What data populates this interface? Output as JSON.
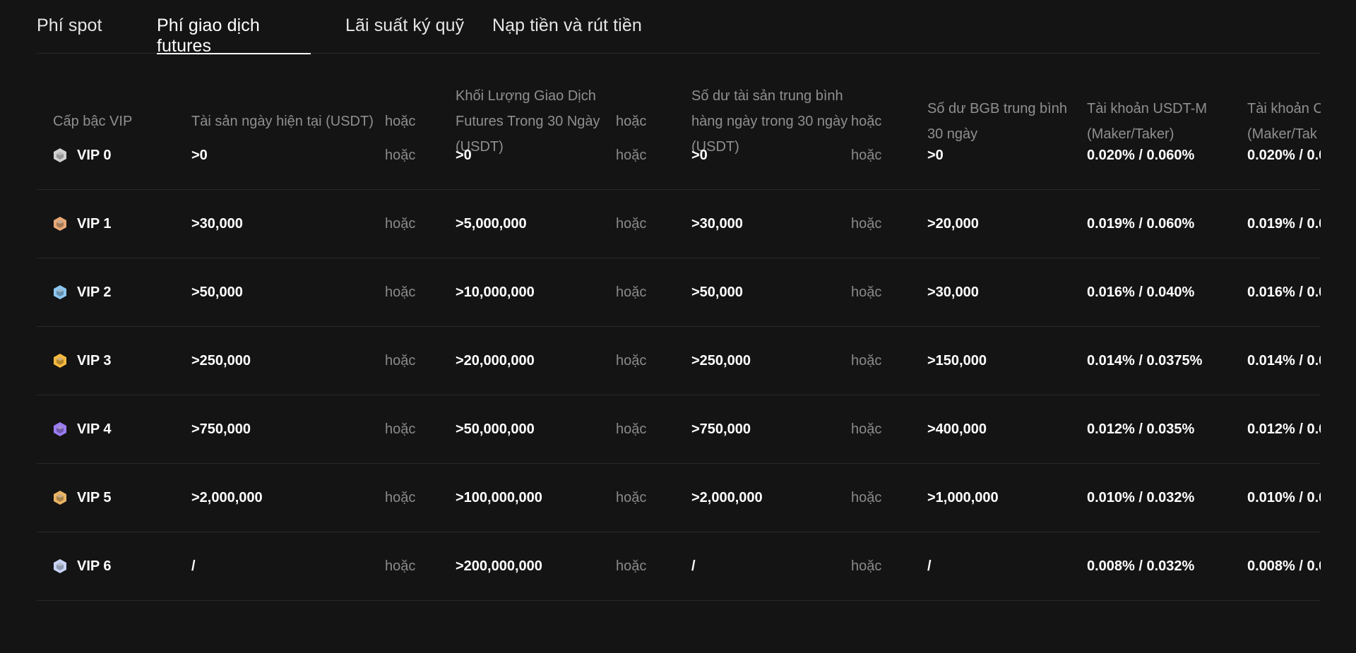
{
  "tabs": [
    {
      "label": "Phí spot",
      "active": false
    },
    {
      "label": "Phí giao dịch futures",
      "active": true
    },
    {
      "label": "Lãi suất ký quỹ",
      "active": false
    },
    {
      "label": "Nạp tiền và rút tiền",
      "active": false
    }
  ],
  "table": {
    "headers": {
      "vip": "Cấp bậc VIP",
      "assets": "Tài sản ngày hiện tại (USDT)",
      "or1": "hoặc",
      "volume": "Khối Lượng Giao Dịch Futures Trong 30 Ngày (USDT)",
      "or2": "hoặc",
      "avg_assets": "Số dư tài sản trung bình hàng ngày trong 30 ngày (USDT)",
      "or3": "hoặc",
      "bgb": "Số dư BGB trung bình 30 ngày",
      "usdt_m": "Tài khoản USDT-M (Maker/Taker)",
      "coin_m": "Tài khoản C (Maker/Tak"
    },
    "or_label": "hoặc",
    "rows": [
      {
        "vip": "VIP 0",
        "icon_color": "#d0d0d0",
        "assets": ">0",
        "volume": ">0",
        "avg_assets": ">0",
        "bgb": ">0",
        "usdt_m": "0.020% / 0.060%",
        "coin_m": "0.020% / 0.0"
      },
      {
        "vip": "VIP 1",
        "icon_color": "#e7a877",
        "assets": ">30,000",
        "volume": ">5,000,000",
        "avg_assets": ">30,000",
        "bgb": ">20,000",
        "usdt_m": "0.019% / 0.060%",
        "coin_m": "0.019% / 0.0"
      },
      {
        "vip": "VIP 2",
        "icon_color": "#8cc6f0",
        "assets": ">50,000",
        "volume": ">10,000,000",
        "avg_assets": ">50,000",
        "bgb": ">30,000",
        "usdt_m": "0.016% / 0.040%",
        "coin_m": "0.016% / 0.0"
      },
      {
        "vip": "VIP 3",
        "icon_color": "#f5b93e",
        "assets": ">250,000",
        "volume": ">20,000,000",
        "avg_assets": ">250,000",
        "bgb": ">150,000",
        "usdt_m": "0.014% / 0.0375%",
        "coin_m": "0.014% / 0.0"
      },
      {
        "vip": "VIP 4",
        "icon_color": "#9b7cf2",
        "assets": ">750,000",
        "volume": ">50,000,000",
        "avg_assets": ">750,000",
        "bgb": ">400,000",
        "usdt_m": "0.012% / 0.035%",
        "coin_m": "0.012% / 0.0"
      },
      {
        "vip": "VIP 5",
        "icon_color": "#e9b564",
        "assets": ">2,000,000",
        "volume": ">100,000,000",
        "avg_assets": ">2,000,000",
        "bgb": ">1,000,000",
        "usdt_m": "0.010% / 0.032%",
        "coin_m": "0.010% / 0.0"
      },
      {
        "vip": "VIP 6",
        "icon_color": "#c8d4f4",
        "assets": "/",
        "volume": ">200,000,000",
        "avg_assets": "/",
        "bgb": "/",
        "usdt_m": "0.008% / 0.032%",
        "coin_m": "0.008% / 0.0"
      }
    ]
  }
}
